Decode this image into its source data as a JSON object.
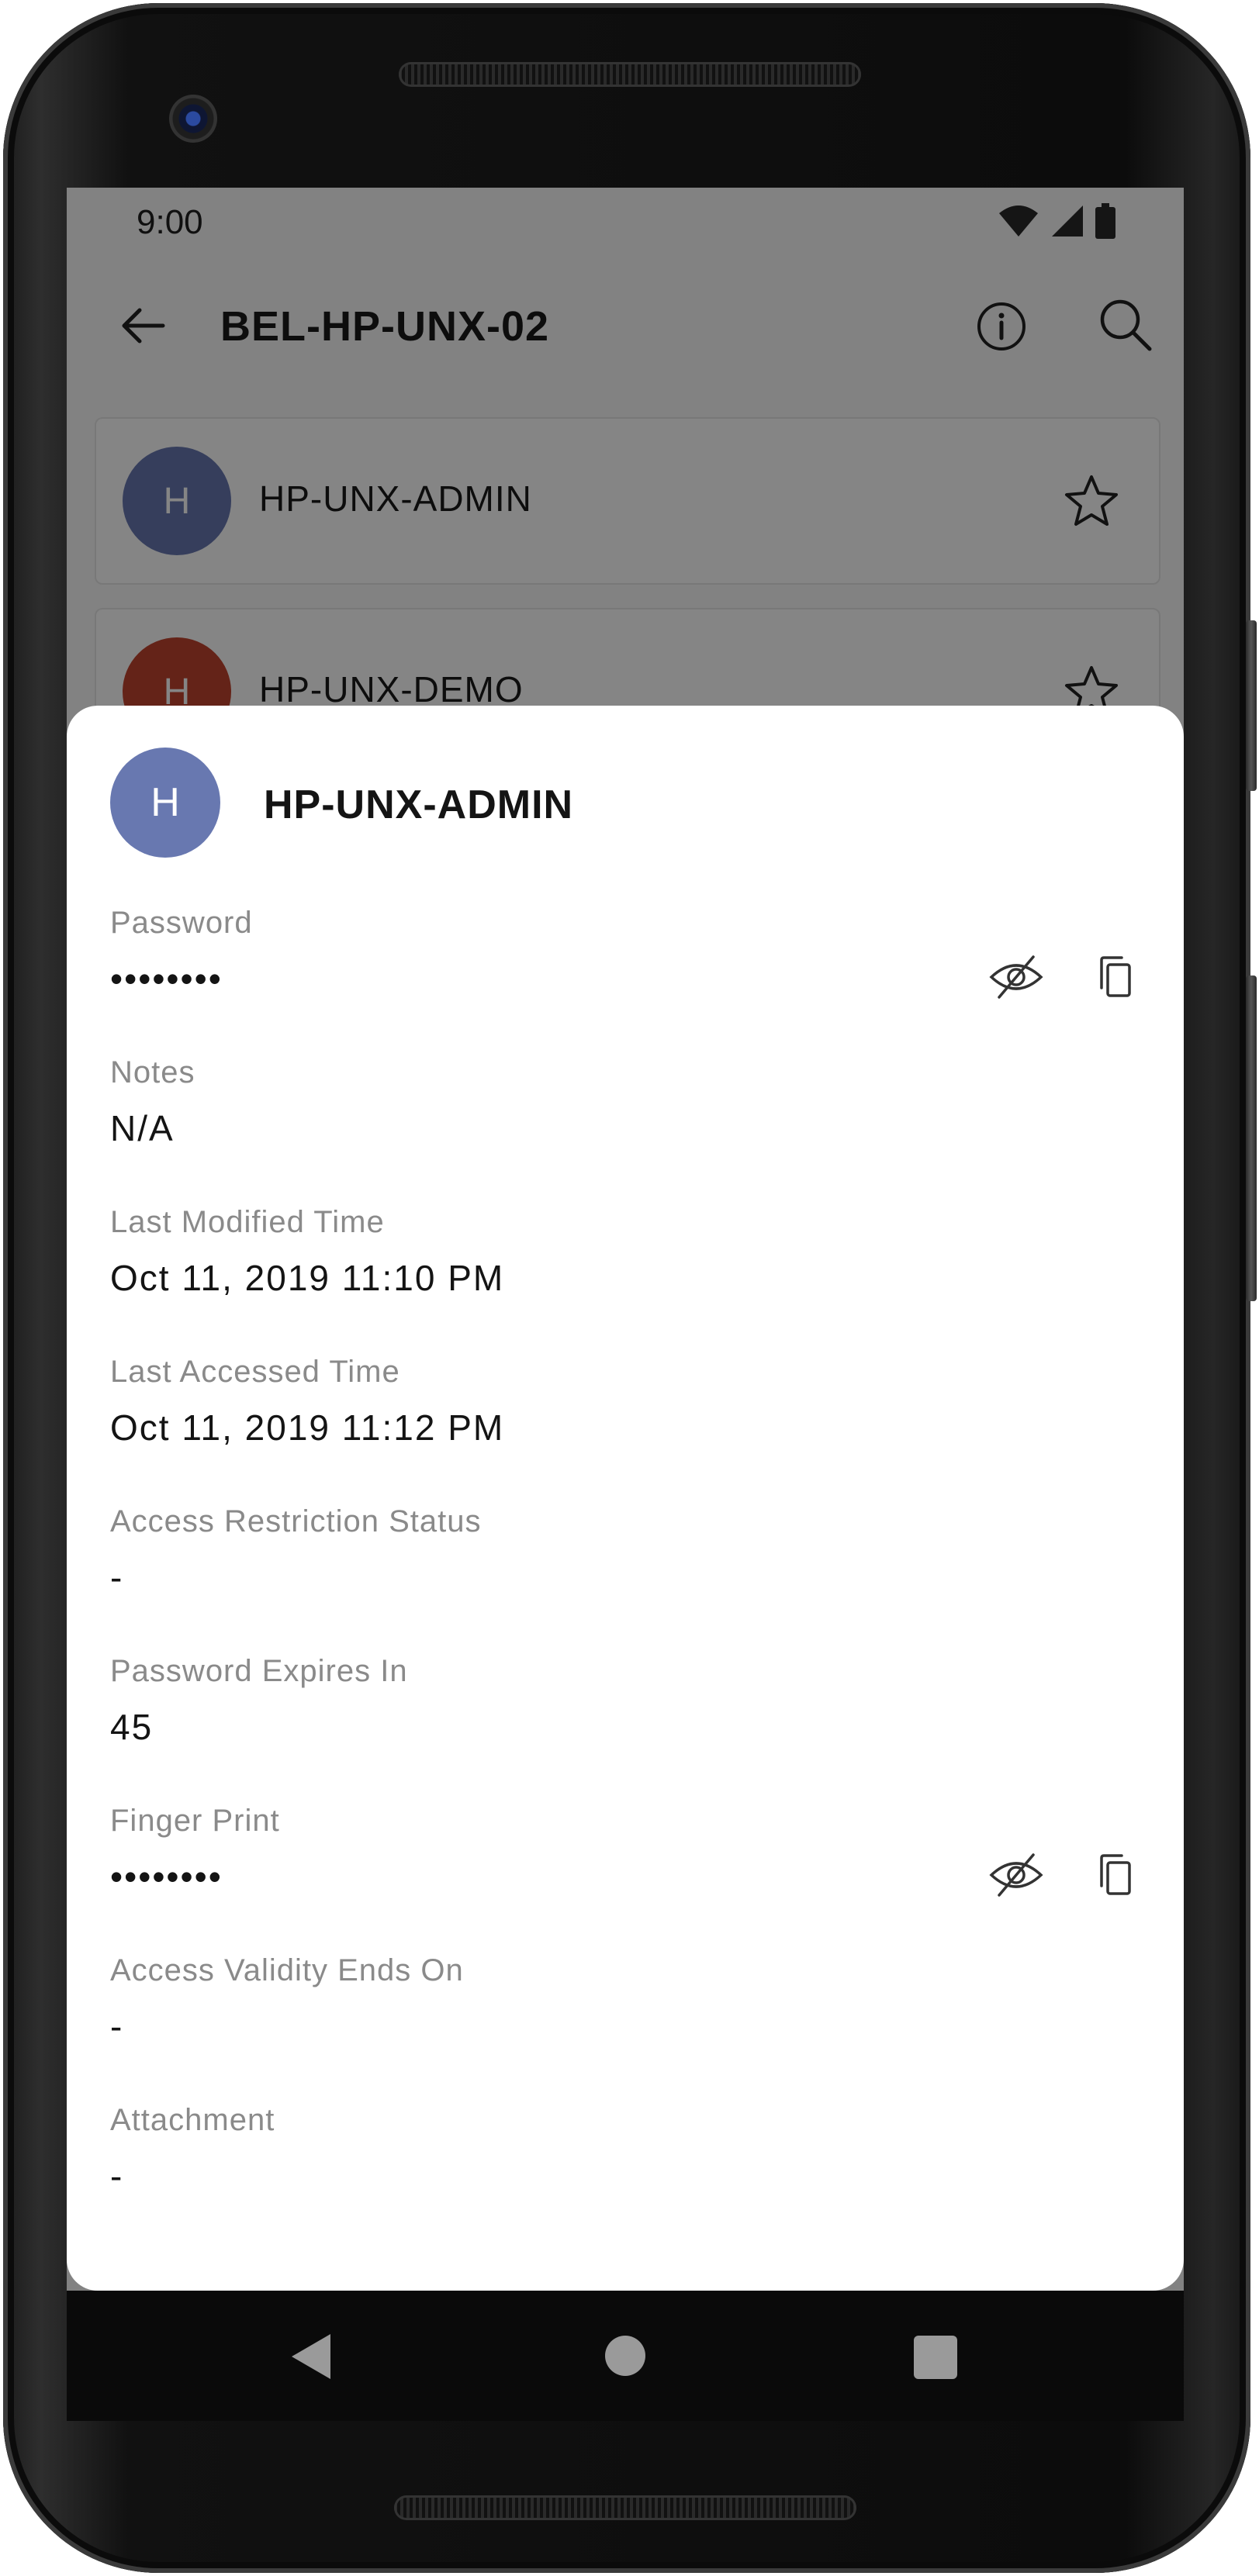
{
  "status_bar": {
    "time": "9:00",
    "icons": [
      "wifi-icon",
      "signal-icon",
      "battery-icon"
    ]
  },
  "toolbar": {
    "title": "BEL-HP-UNX-02",
    "back_icon": "arrow-left-icon",
    "info_icon": "info-icon",
    "search_icon": "search-icon"
  },
  "list": {
    "items": [
      {
        "initial": "H",
        "name": "HP-UNX-ADMIN",
        "avatar_color": "#6878b0"
      },
      {
        "initial": "H",
        "name": "HP-UNX-DEMO",
        "avatar_color": "#c0432f"
      }
    ]
  },
  "sheet": {
    "initial": "H",
    "title": "HP-UNX-ADMIN",
    "fields": [
      {
        "label": "Password",
        "value": "••••••••",
        "actions": [
          "eye-off-icon",
          "copy-icon"
        ]
      },
      {
        "label": "Notes",
        "value": "N/A"
      },
      {
        "label": "Last Modified Time",
        "value": "Oct 11, 2019 11:10 PM"
      },
      {
        "label": "Last Accessed Time",
        "value": "Oct 11, 2019 11:12 PM"
      },
      {
        "label": "Access Restriction Status",
        "value": "-"
      },
      {
        "label": "Password Expires In",
        "value": "45"
      },
      {
        "label": "Finger Print",
        "value": "••••••••",
        "actions": [
          "eye-off-icon",
          "copy-icon"
        ]
      },
      {
        "label": "Access Validity Ends On",
        "value": "-"
      },
      {
        "label": "Attachment",
        "value": "-"
      }
    ]
  },
  "nav_bar": {
    "buttons": [
      "back-triangle-icon",
      "home-circle-icon",
      "recents-square-icon"
    ]
  },
  "colors": {
    "avatar_blue": "#6878b0",
    "avatar_red": "#c0432f",
    "label_gray": "#8a8a8a"
  }
}
